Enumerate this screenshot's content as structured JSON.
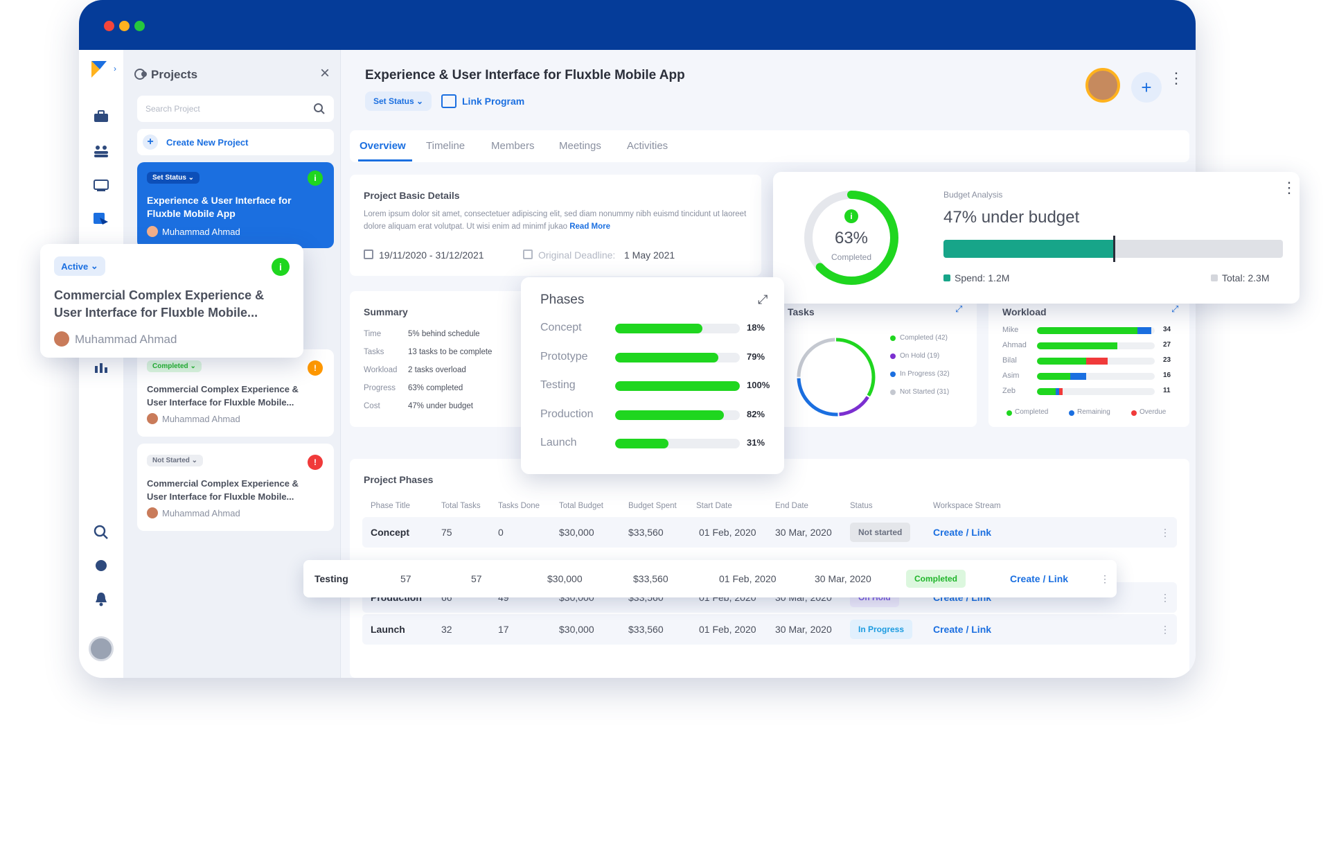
{
  "sidebar_projects": {
    "title": "Projects",
    "search_placeholder": "Search Project",
    "create_label": "Create New Project",
    "selected": {
      "status": "Set Status",
      "title": "Experience & User Interface for Fluxble Mobile App",
      "owner": "Muhammad Ahmad"
    },
    "items": [
      {
        "status": "Completed",
        "title": "Commercial Complex Experience & User Interface for Fluxble Mobile...",
        "owner": "Muhammad Ahmad",
        "indicator": "#ff9800"
      },
      {
        "status": "Not Started",
        "title": "Commercial Complex Experience & User Interface for Fluxble Mobile...",
        "owner": "Muhammad Ahmad",
        "indicator": "#f03a3a"
      }
    ]
  },
  "floating_project": {
    "status": "Active",
    "title": "Commercial Complex Experience & User Interface for Fluxble Mobile...",
    "owner": "Muhammad Ahmad"
  },
  "header": {
    "title": "Experience & User Interface for Fluxble Mobile App",
    "set_status": "Set Status",
    "link_program": "Link Program"
  },
  "tabs": [
    "Overview",
    "Timeline",
    "Members",
    "Meetings",
    "Activities"
  ],
  "basic_details": {
    "title": "Project Basic Details",
    "description": "Lorem ipsum dolor sit amet, consectetuer adipiscing elit, sed diam nonummy nibh euismd tincidunt ut laoreet dolore aliquam erat volutpat. Ut wisi enim ad minimf jukao",
    "read_more": "Read More",
    "date_range": "19/11/2020 - 31/12/2021",
    "deadline_label": "Original Deadline:",
    "deadline_value": "1 May 2021"
  },
  "summary": {
    "title": "Summary",
    "rows": [
      {
        "label": "Time",
        "value": "5% behind schedule"
      },
      {
        "label": "Tasks",
        "value": "13 tasks to be complete"
      },
      {
        "label": "Workload",
        "value": "2 tasks overload"
      },
      {
        "label": "Progress",
        "value": "63% completed"
      },
      {
        "label": "Cost",
        "value": "47% under budget"
      }
    ]
  },
  "phases_popup": {
    "title": "Phases",
    "items": [
      {
        "name": "Concept",
        "percent": 18,
        "label": "18%",
        "fill": 0.7
      },
      {
        "name": "Prototype",
        "percent": 79,
        "label": "79%",
        "fill": 0.83
      },
      {
        "name": "Testing",
        "percent": 100,
        "label": "100%",
        "fill": 1.0
      },
      {
        "name": "Production",
        "percent": 82,
        "label": "82%",
        "fill": 0.87
      },
      {
        "name": "Launch",
        "percent": 31,
        "label": "31%",
        "fill": 0.43
      }
    ]
  },
  "budget": {
    "label": "Budget Analysis",
    "headline": "47% under budget",
    "spend": "Spend: 1.2M",
    "total": "Total: 2.3M",
    "spend_fraction": 0.5,
    "progress_percent": "63%",
    "progress_label": "Completed",
    "progress_fraction": 0.63
  },
  "tasks": {
    "title": "Tasks",
    "legend": [
      {
        "label": "Completed (42)",
        "color": "#1fd61f",
        "value": 42
      },
      {
        "label": "On Hold (19)",
        "color": "#7b2fd0",
        "value": 19
      },
      {
        "label": "In Progress (32)",
        "color": "#1b6fe0",
        "value": 32
      },
      {
        "label": "Not Started (31)",
        "color": "#c4c8d0",
        "value": 31
      }
    ]
  },
  "workload": {
    "title": "Workload",
    "people": [
      {
        "name": "Mike",
        "value": "34",
        "completed": 0.85,
        "remaining": 0.12,
        "overdue": 0
      },
      {
        "name": "Ahmad",
        "value": "27",
        "completed": 0.68,
        "remaining": 0,
        "overdue": 0
      },
      {
        "name": "Bilal",
        "value": "23",
        "completed": 0.42,
        "remaining": 0,
        "overdue": 0.18
      },
      {
        "name": "Asim",
        "value": "16",
        "completed": 0.28,
        "remaining": 0.14,
        "overdue": 0
      },
      {
        "name": "Zeb",
        "value": "11",
        "completed": 0.16,
        "remaining": 0.03,
        "overdue": 0.03
      }
    ],
    "legend": [
      {
        "label": "Completed",
        "color": "#1fd61f"
      },
      {
        "label": "Remaining",
        "color": "#1b6fe0"
      },
      {
        "label": "Overdue",
        "color": "#f03a3a"
      }
    ]
  },
  "project_phases": {
    "title": "Project Phases",
    "columns": [
      "Phase Title",
      "Total Tasks",
      "Tasks Done",
      "Total Budget",
      "Budget Spent",
      "Start Date",
      "End Date",
      "Status",
      "Workspace Stream"
    ],
    "rows": [
      {
        "phase": "Concept",
        "total": "75",
        "done": "0",
        "budget": "$30,000",
        "spent": "$33,560",
        "start": "01 Feb, 2020",
        "end": "30 Mar, 2020",
        "status": "Not started",
        "stream": "Create / Link"
      },
      {
        "phase": "Testing",
        "total": "57",
        "done": "57",
        "budget": "$30,000",
        "spent": "$33,560",
        "start": "01 Feb, 2020",
        "end": "30 Mar, 2020",
        "status": "Completed",
        "stream": "Create / Link"
      },
      {
        "phase": "Production",
        "total": "66",
        "done": "49",
        "budget": "$30,000",
        "spent": "$33,560",
        "start": "01 Feb, 2020",
        "end": "30 Mar, 2020",
        "status": "On Hold",
        "stream": "Create / Link"
      },
      {
        "phase": "Launch",
        "total": "32",
        "done": "17",
        "budget": "$30,000",
        "spent": "$33,560",
        "start": "01 Feb, 2020",
        "end": "30 Mar, 2020",
        "status": "In Progress",
        "stream": "Create / Link"
      }
    ]
  },
  "colors": {
    "brand": "#053c99",
    "accent": "#1b6fe0",
    "green": "#1fd61f",
    "teal": "#17a589"
  }
}
